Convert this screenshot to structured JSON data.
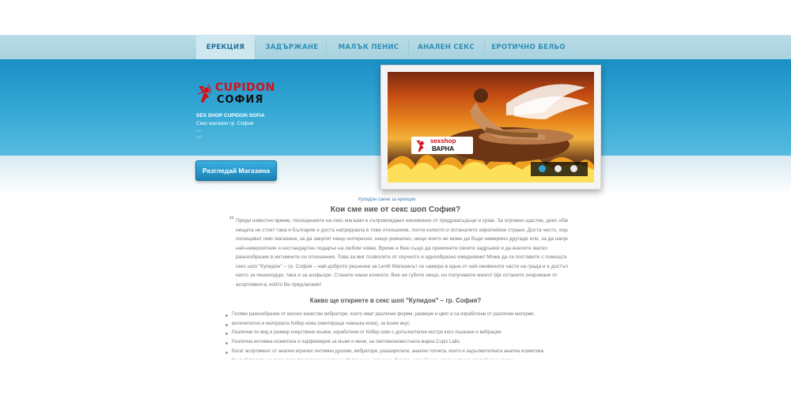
{
  "nav": {
    "items": [
      {
        "label": "ЕРЕКЦИЯ",
        "active": true
      },
      {
        "label": "ЗАДЪРЖАНЕ"
      },
      {
        "label": "МАЛЪК ПЕНИС"
      },
      {
        "label": "АНАЛЕН СЕКС"
      },
      {
        "label": "ЕРОТИЧНО БЕЛЬО"
      }
    ]
  },
  "logo": {
    "top": "CUPIDON",
    "bottom": "СОФИЯ"
  },
  "hero": {
    "line1": "SEX SHOP CUPIDON SOFIA",
    "line2": "Секс магазин гр. София",
    "line3": "---",
    "line4": "---",
    "button": "Разгледай Магазина"
  },
  "slider": {
    "badge_line1": "sexshop",
    "badge_line2": "ВАРНА",
    "dots": 3,
    "active_dot": 1
  },
  "caption": "Купидон сакче за ерекция",
  "intro_heading": "Кои сме ние от секс шоп София?",
  "intro_lines": [
    "Преди известно време, посещението на секс магазин е съпровождано неизменно от предразсъдъци и срам. За огромно щастие, днес обаче",
    "нещата не стоят така и България е доста напреднала в това отношение, почти колкото и останалите европейски страни. Доста често, хората",
    "посещават секс магазина, за да закупят нещо интересно, нещо уникално, нещо което ни може да бъде намерено другаде или, за да направят",
    "най-невероятния и нестандартен подарък на любим човек. Време е Вие също да преминете своите задръжки и да внесете малко",
    "разнообразие в интимните си отношения. Това за миг позволите от скучното и еднообразно ежедневие! Може да се поставите с помощта на",
    "секс шоп \"Купидон\" – гр. София – най-доброто решение за Lentil Магазинът се намира в една от най-оживените части на града и е достъпен,",
    "както за пешеходци, така и за шофьори. Станете наши клиенти. Вие не губите нищо, но получавате много! Ще останете очаровани от",
    "асортимента, който Ви предлагаме!"
  ],
  "list_heading": "Какво ще откриете в секс шоп \"Купидон\" – гр. София?",
  "list_items": [
    "Голямо разнообразие от високо качество вибратори, които имат различни форми, размери и цвят и са изработени от различни материи,",
    "включително и материала Кибер кожа (имитираща човешка кожа), за всеки вкус.",
    "Различни по вид и размер изкуствени мъжки, изработени от Кибер скин с допълнителни екстри като пъшкане и вибрации.",
    "Различна интимна козметика и парфюмерия за мъже и жени, на световноизвестната марка Cupis Labs.",
    "Богат асортимент от анални играчки: интимни душове, вибратори, разширители, анални топчета, които и задължителната анална козметика.",
    "За любителите на садо-мазо предлагаме различни белезници, камшици, бичове, нашийници, кожени пенис-нахрайници, маски."
  ],
  "colors": {
    "accent": "#1a8fc4",
    "brand_red": "#d4111b",
    "nav_bg": "#b2d8e3"
  }
}
